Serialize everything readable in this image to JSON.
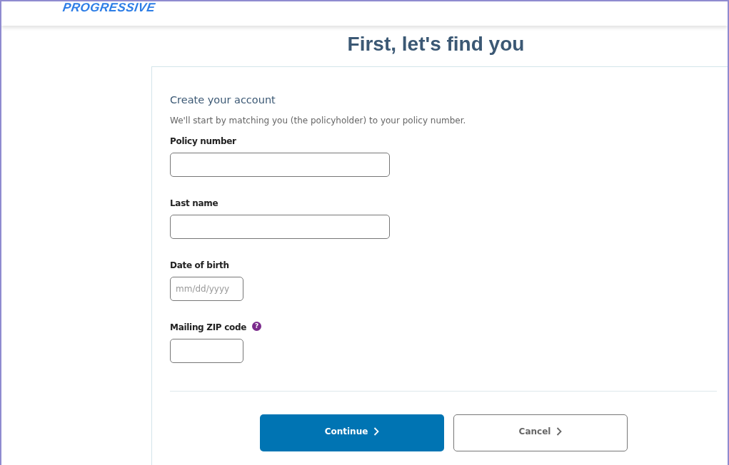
{
  "header": {
    "logo": "PROGRESSIVE"
  },
  "heading": "First, let's find you",
  "form": {
    "title": "Create your account",
    "intro": "We'll start by matching you (the policyholder) to your policy number.",
    "fields": [
      {
        "label": "Policy number",
        "kind": "wide"
      },
      {
        "label": "Last name",
        "kind": "wide"
      },
      {
        "label": "Date of birth",
        "kind": "short",
        "placeholder": "mm/dd/yyyy"
      },
      {
        "label": "Mailing ZIP code",
        "kind": "short",
        "help": "?"
      }
    ]
  },
  "buttons": [
    {
      "label": "Continue",
      "kind": "primary"
    },
    {
      "label": "Cancel",
      "kind": "secondary"
    }
  ]
}
